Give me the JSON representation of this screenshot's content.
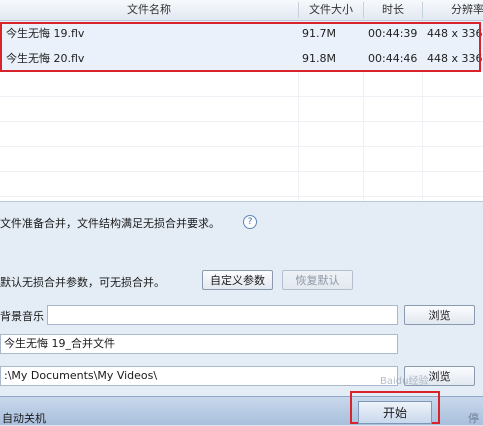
{
  "table": {
    "headers": {
      "name": "文件名称",
      "size": "文件大小",
      "duration": "时长",
      "resolution": "分辨率"
    },
    "rows": [
      {
        "name": "今生无悔 19.flv",
        "size": "91.7M",
        "duration": "00:44:39",
        "resolution": "448 x 336"
      },
      {
        "name": "今生无悔 20.flv",
        "size": "91.8M",
        "duration": "00:44:46",
        "resolution": "448 x 336"
      }
    ]
  },
  "merge": {
    "status_text": "文件准备合并，文件结构满足无损合并要求。",
    "help_icon": "?",
    "params_text": "默认无损合并参数，可无损合并。",
    "custom_params_label": "自定义参数",
    "restore_default_label": "恢复默认",
    "bg_music_label": "背景音乐",
    "bg_music_value": "",
    "browse_label_1": "浏览",
    "output_name_value": "今生无悔 19_合并文件",
    "output_path_value": ":\\My Documents\\My Videos\\",
    "browse_label_2": "浏览"
  },
  "footer": {
    "auto_shutdown_label": "自动关机",
    "start_label": "开始",
    "stop_label": "停"
  },
  "watermark": "Baidu经验"
}
